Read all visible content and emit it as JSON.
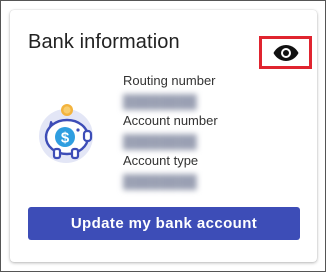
{
  "card": {
    "title": "Bank information",
    "visibility_icon": "eye-icon",
    "illustration_icon": "piggy-bank-icon",
    "accent_color": "#3d4db7",
    "highlight_color": "#e0242f"
  },
  "fields": {
    "routing": {
      "label": "Routing number",
      "value": ""
    },
    "account": {
      "label": "Account number",
      "value": ""
    },
    "type": {
      "label": "Account type",
      "value": ""
    }
  },
  "actions": {
    "update_label": "Update my bank account"
  }
}
